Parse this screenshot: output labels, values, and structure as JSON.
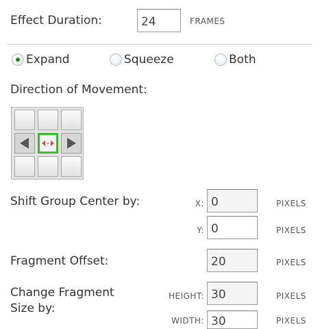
{
  "effect_duration": {
    "label": "Effect Duration:",
    "value": "24",
    "unit": "FRAMES"
  },
  "mode": {
    "options": [
      {
        "label": "Expand",
        "checked": true
      },
      {
        "label": "Squeeze",
        "checked": false
      },
      {
        "label": "Both",
        "checked": false
      }
    ]
  },
  "direction": {
    "label": "Direction of Movement:",
    "selected": "center"
  },
  "shift_group_center": {
    "label": "Shift Group Center by:",
    "x_label": "X:",
    "x_value": "0",
    "y_label": "Y:",
    "y_value": "0",
    "unit": "PIXELS"
  },
  "fragment_offset": {
    "label": "Fragment Offset:",
    "value": "20",
    "unit": "PIXELS"
  },
  "change_fragment_size": {
    "label_line1": "Change Fragment",
    "label_line2": "Size by:",
    "height_label": "HEIGHT:",
    "height_value": "30",
    "width_label": "WIDTH:",
    "width_value": "30",
    "unit": "PIXELS"
  },
  "colors": {
    "selected_green": "#3cba2f",
    "divider": "#cccccc"
  }
}
